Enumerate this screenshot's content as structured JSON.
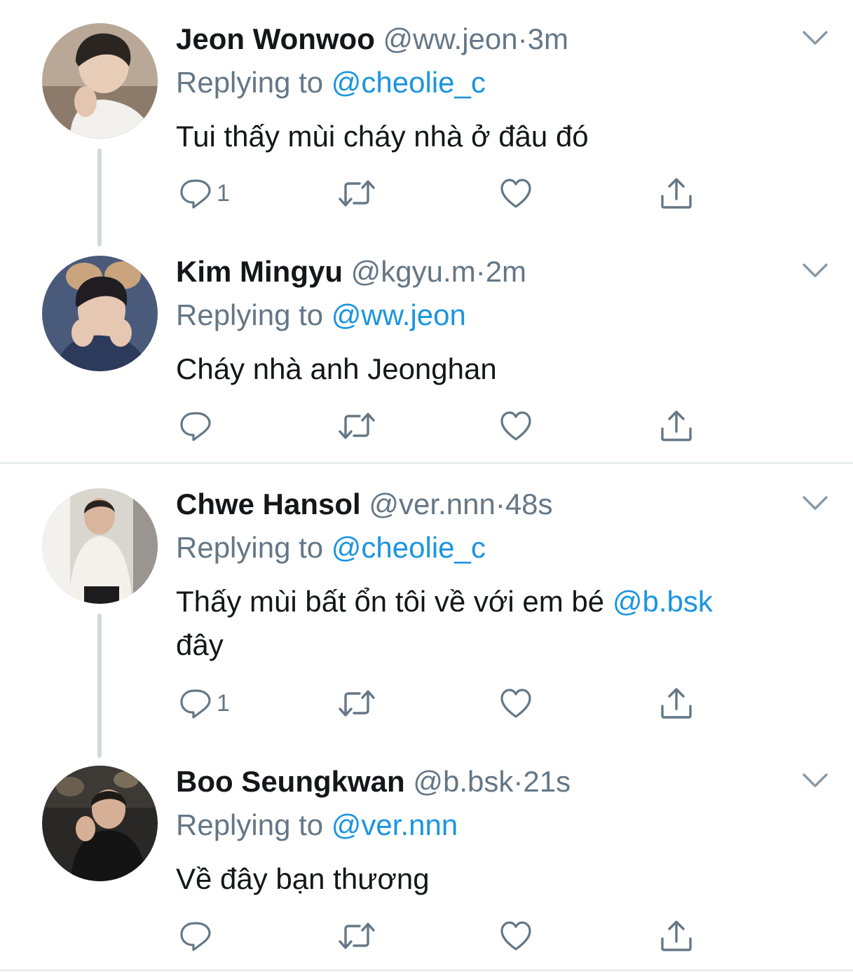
{
  "colors": {
    "link": "#1b95e0",
    "secondary": "#657786",
    "divider": "#e1e8ed",
    "thread": "#cfd9de"
  },
  "tweets": [
    {
      "name": "Jeon Wonwoo",
      "handle": "@ww.jeon",
      "dot": "·",
      "time": "3m",
      "replying_prefix": "Replying to",
      "replying_to": "@cheolie_c",
      "text": "Tui thấy mùi cháy nhà ở đâu đó",
      "reply_count": "1",
      "icons": [
        "reply-icon",
        "retweet-icon",
        "like-icon",
        "share-icon",
        "chevron-down-icon"
      ]
    },
    {
      "name": "Kim Mingyu",
      "handle": "@kgyu.m",
      "dot": "·",
      "time": "2m",
      "replying_prefix": "Replying to",
      "replying_to": "@ww.jeon",
      "text": "Cháy nhà anh Jeonghan",
      "reply_count": "",
      "icons": [
        "reply-icon",
        "retweet-icon",
        "like-icon",
        "share-icon",
        "chevron-down-icon"
      ]
    },
    {
      "name": "Chwe Hansol",
      "handle": "@ver.nnn",
      "dot": "·",
      "time": "48s",
      "replying_prefix": "Replying to",
      "replying_to": "@cheolie_c",
      "text_before": "Thấy mùi bất ổn tôi về với em bé ",
      "text_mention": "@b.bsk",
      "text_after": "đây",
      "reply_count": "1",
      "icons": [
        "reply-icon",
        "retweet-icon",
        "like-icon",
        "share-icon",
        "chevron-down-icon"
      ]
    },
    {
      "name": "Boo Seungkwan",
      "handle": "@b.bsk",
      "dot": "·",
      "time": "21s",
      "replying_prefix": "Replying to",
      "replying_to": "@ver.nnn",
      "text": "Về đây bạn thương",
      "reply_count": "",
      "icons": [
        "reply-icon",
        "retweet-icon",
        "like-icon",
        "share-icon",
        "chevron-down-icon"
      ]
    }
  ]
}
